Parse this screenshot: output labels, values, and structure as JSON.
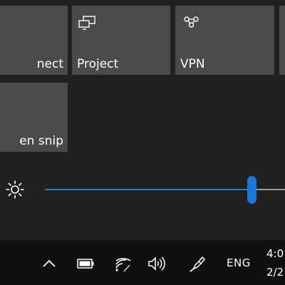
{
  "quick_actions": {
    "tiles": [
      {
        "label": "nect",
        "icon": "connect-icon"
      },
      {
        "label": "Project",
        "icon": "project-icon"
      },
      {
        "label": "VPN",
        "icon": "vpn-icon"
      },
      {
        "label": "",
        "icon": ""
      },
      {
        "label": "en snip",
        "icon": "screen-snip-icon"
      }
    ]
  },
  "brightness": {
    "icon": "brightness-icon",
    "value_fraction": 0.84
  },
  "taskbar": {
    "icons": [
      "chevron-up-icon",
      "battery-icon",
      "wifi-icon",
      "volume-icon",
      "pen-icon"
    ],
    "language": "ENG",
    "time": "4:0",
    "date": "2/2"
  },
  "colors": {
    "background": "#202020",
    "tile": "#4a4a4a",
    "accent": "#1c76d8",
    "taskbar": "#101010"
  }
}
